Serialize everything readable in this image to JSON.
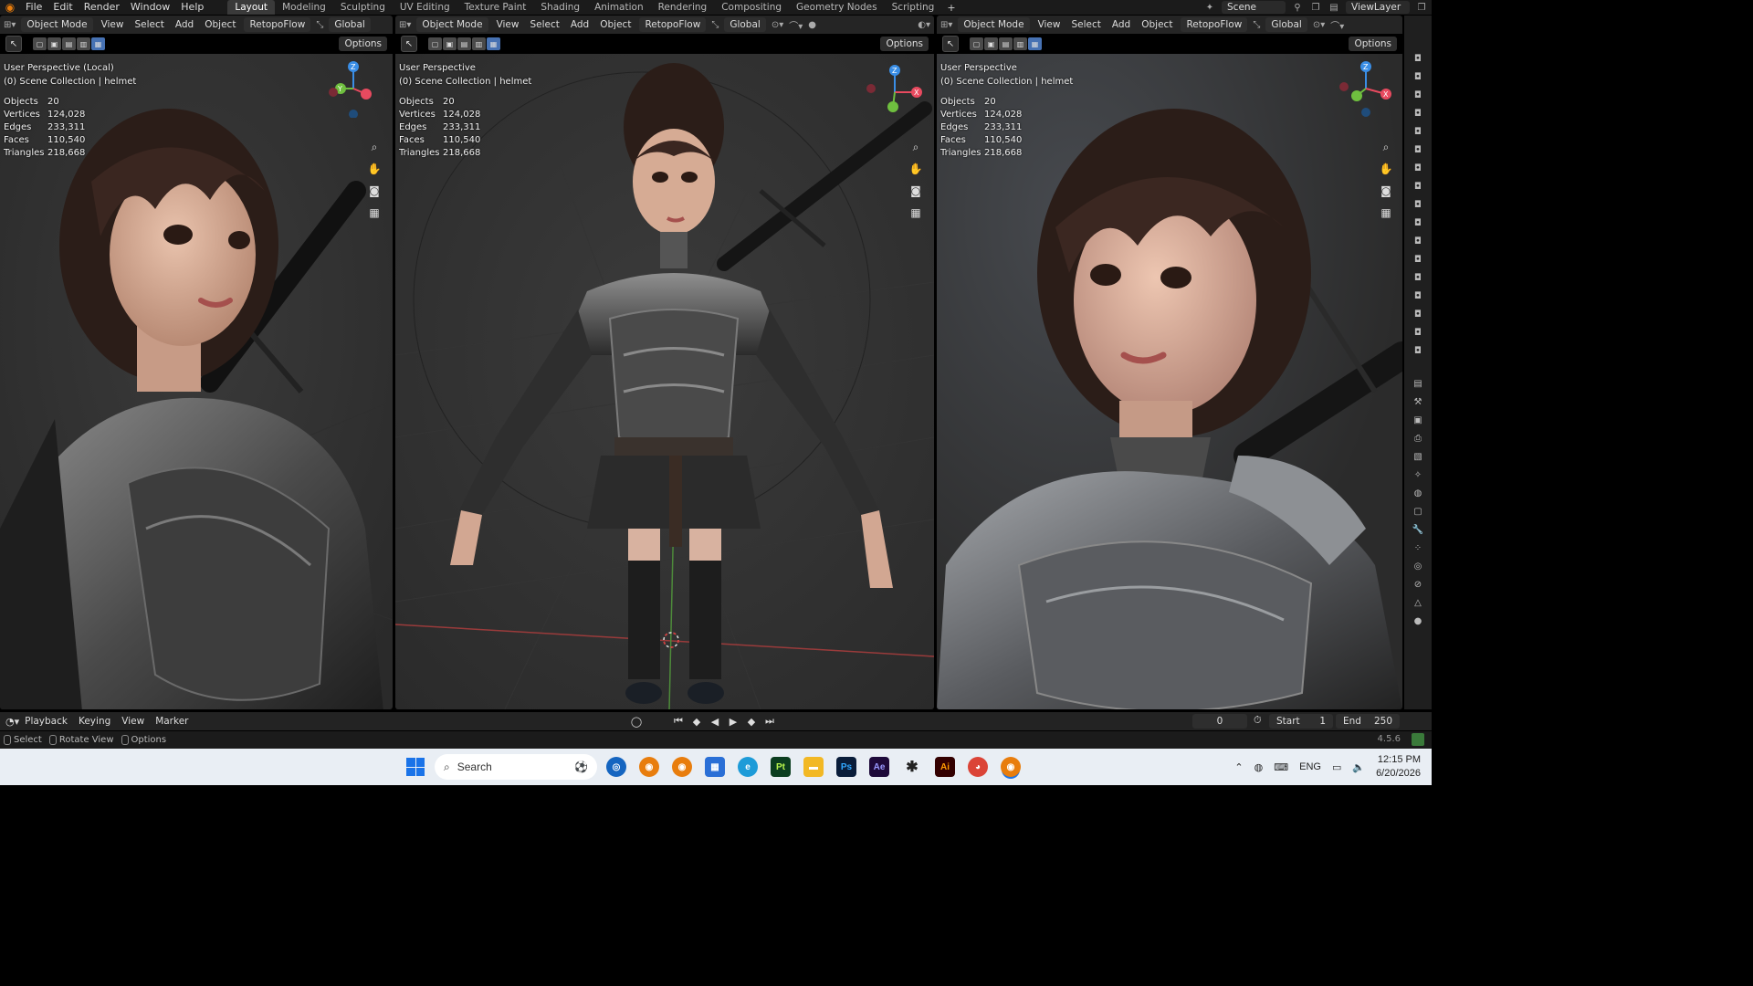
{
  "topbar": {
    "menus": [
      "File",
      "Edit",
      "Render",
      "Window",
      "Help"
    ],
    "workspaces": [
      "Layout",
      "Modeling",
      "Sculpting",
      "UV Editing",
      "Texture Paint",
      "Shading",
      "Animation",
      "Rendering",
      "Compositing",
      "Geometry Nodes",
      "Scripting"
    ],
    "active_workspace": "Layout",
    "scene": "Scene",
    "view_layer": "ViewLayer"
  },
  "viewports": [
    {
      "mode": "Object Mode",
      "menus": [
        "View",
        "Select",
        "Add",
        "Object"
      ],
      "addon": "RetopoFlow",
      "orientation": "Global",
      "options": "Options",
      "perspective": "User Perspective (Local)",
      "collection": "(0) Scene Collection | helmet",
      "stats": [
        {
          "k": "Objects",
          "v": "20"
        },
        {
          "k": "Vertices",
          "v": "124,028"
        },
        {
          "k": "Edges",
          "v": "233,311"
        },
        {
          "k": "Faces",
          "v": "110,540"
        },
        {
          "k": "Triangles",
          "v": "218,668"
        }
      ]
    },
    {
      "mode": "Object Mode",
      "menus": [
        "View",
        "Select",
        "Add",
        "Object"
      ],
      "addon": "RetopoFlow",
      "orientation": "Global",
      "options": "Options",
      "perspective": "User Perspective",
      "collection": "(0) Scene Collection | helmet",
      "stats": [
        {
          "k": "Objects",
          "v": "20"
        },
        {
          "k": "Vertices",
          "v": "124,028"
        },
        {
          "k": "Edges",
          "v": "233,311"
        },
        {
          "k": "Faces",
          "v": "110,540"
        },
        {
          "k": "Triangles",
          "v": "218,668"
        }
      ]
    },
    {
      "mode": "Object Mode",
      "menus": [
        "View",
        "Select",
        "Add",
        "Object"
      ],
      "addon": "RetopoFlow",
      "orientation": "Global",
      "options": "Options",
      "perspective": "User Perspective",
      "collection": "(0) Scene Collection | helmet",
      "stats": [
        {
          "k": "Objects",
          "v": "20"
        },
        {
          "k": "Vertices",
          "v": "124,028"
        },
        {
          "k": "Edges",
          "v": "233,311"
        },
        {
          "k": "Faces",
          "v": "110,540"
        },
        {
          "k": "Triangles",
          "v": "218,668"
        }
      ]
    }
  ],
  "gizmo_axes": {
    "z": "Z",
    "y": "Y",
    "x": "X"
  },
  "timeline": {
    "menus": [
      "Playback",
      "Keying",
      "View",
      "Marker"
    ],
    "current_frame": "0",
    "start_label": "Start",
    "start": "1",
    "end_label": "End",
    "end": "250"
  },
  "statusbar": {
    "select": "Select",
    "rotate": "Rotate View",
    "options": "Options",
    "version": "4.5.6"
  },
  "taskbar": {
    "search_placeholder": "Search",
    "language": "ENG",
    "time": "12:15 PM",
    "date": "6/20/2026"
  },
  "colors": {
    "blender_orange": "#e87d0d",
    "axis_x": "#e84a5f",
    "axis_y": "#6fbf3f",
    "axis_z": "#3a8ee6",
    "accent_blue": "#4772b3"
  }
}
